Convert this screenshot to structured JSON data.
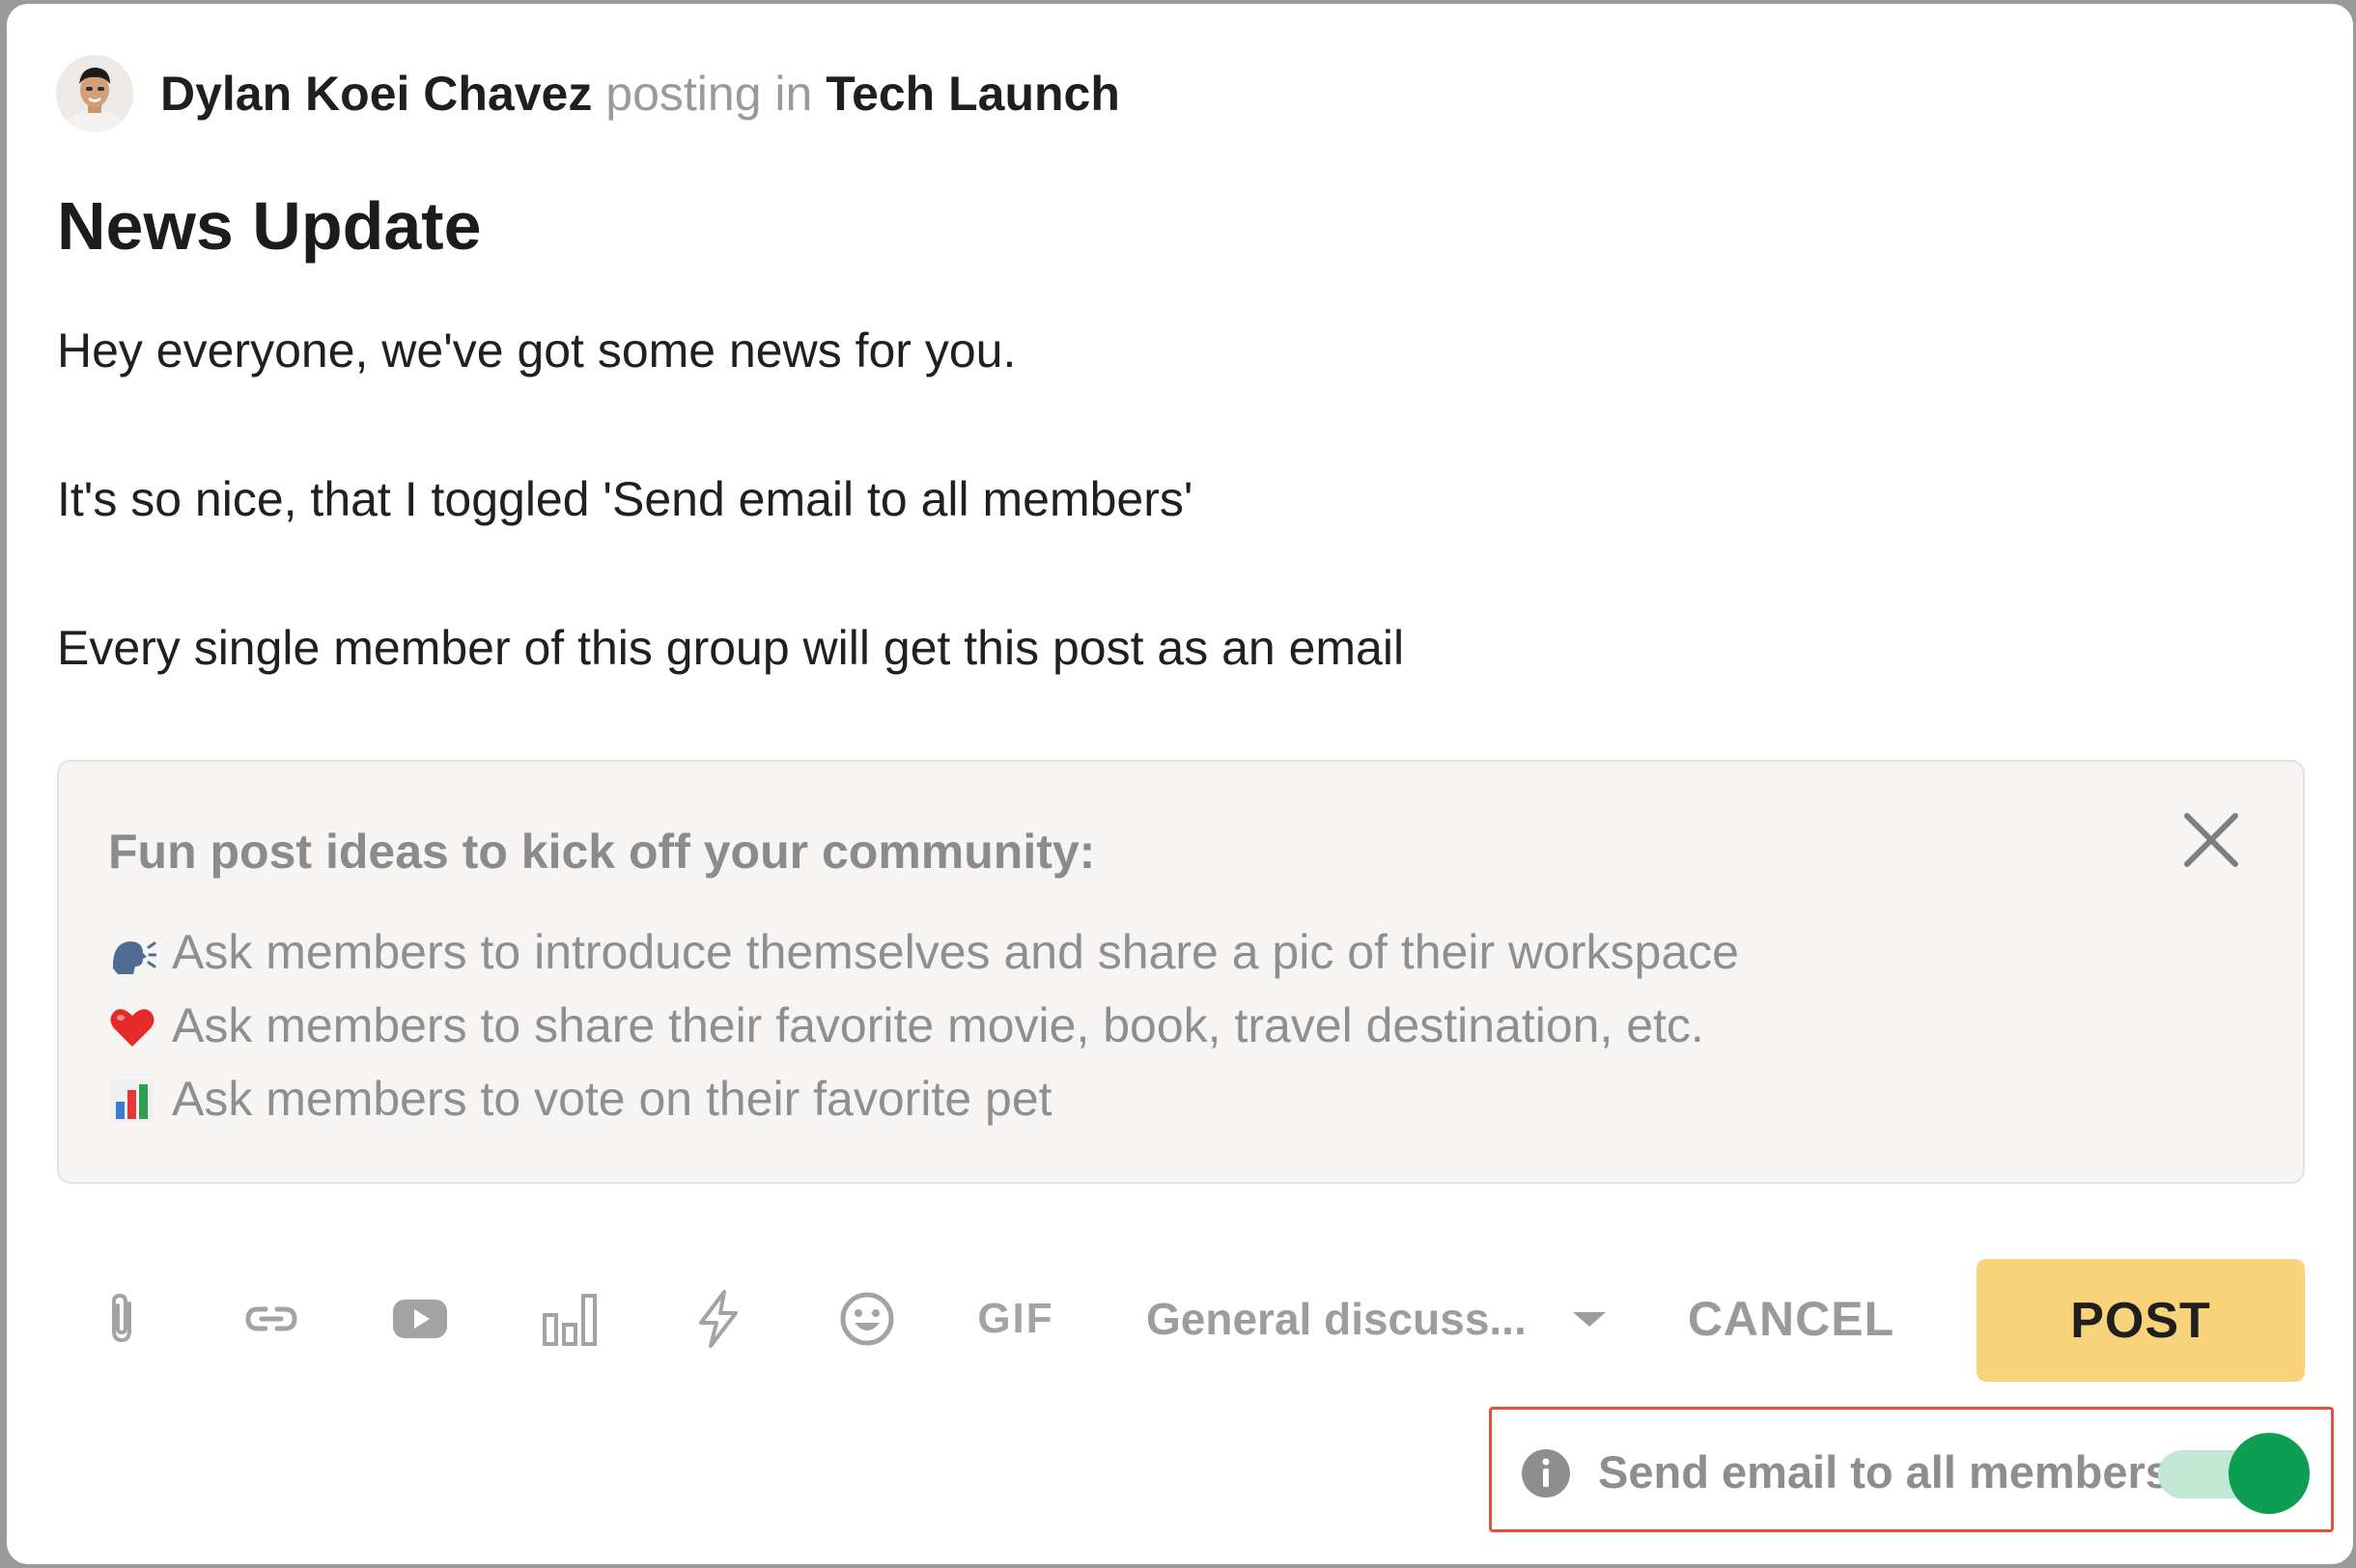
{
  "post": {
    "author": "Dylan Koei Chavez",
    "posting_in": "posting in",
    "group": "Tech Launch",
    "title": "News Update",
    "body_lines": [
      "Hey everyone, we've got some news for you.",
      "It's so nice, that I toggled 'Send email to all members'",
      "Every single member of this group will get this post as an email"
    ]
  },
  "ideas": {
    "title": "Fun post ideas to kick off your community:",
    "items": [
      {
        "icon": "speaking-head-icon",
        "text": "Ask members to introduce themselves and share a pic of their workspace"
      },
      {
        "icon": "heart-icon",
        "text": "Ask members to share their favorite movie, book, travel destination, etc."
      },
      {
        "icon": "bar-chart-icon",
        "text": "Ask members to vote on their favorite pet"
      }
    ]
  },
  "toolbar": {
    "tools": [
      "paperclip-icon",
      "link-icon",
      "youtube-icon",
      "poll-icon",
      "lightning-icon",
      "emoji-icon",
      "gif-icon"
    ],
    "gif_label": "GIF",
    "category": "General discuss...",
    "cancel_label": "CANCEL",
    "post_label": "POST"
  },
  "email": {
    "label": "Send email to all members",
    "enabled": true
  },
  "colors": {
    "post_button": "#f8d37a",
    "toggle_on": "#0c9e52",
    "toggle_track": "#c2e8d5",
    "highlight_border": "#e0503a"
  }
}
